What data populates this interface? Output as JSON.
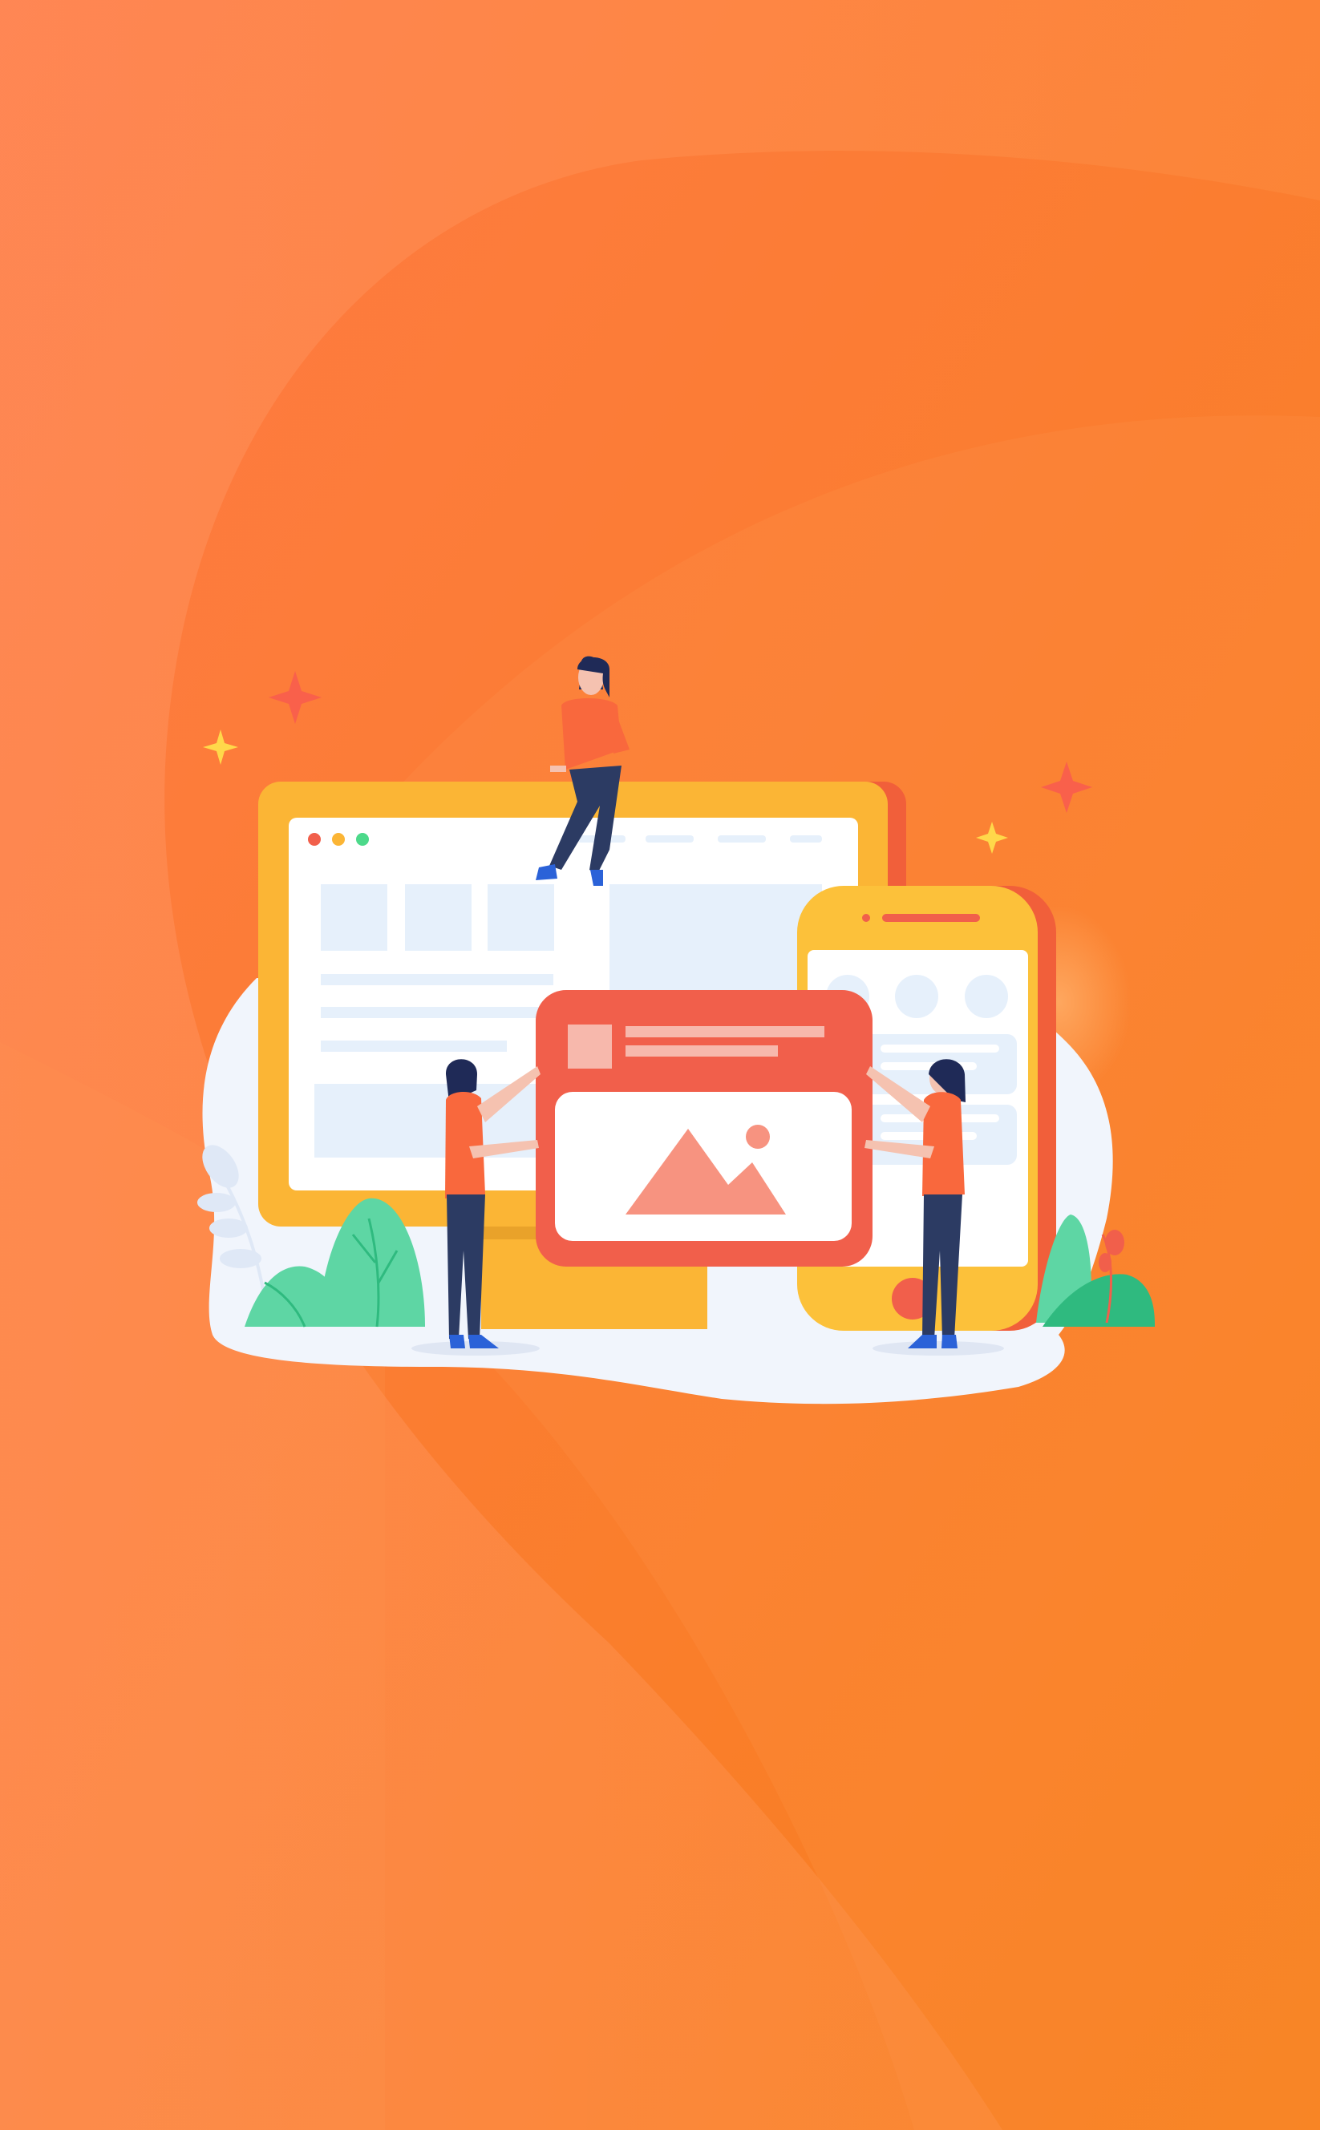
{
  "screen": {
    "kind": "splash-illustration",
    "description_visible_text": "",
    "text_labels": []
  },
  "palette": {
    "bg_top_left": "#ff7a45",
    "bg_bottom_right": "#f7801c",
    "bg_swoosh": "#ff8f5a",
    "monitor_frame": "#fbb535",
    "monitor_frame_shadow": "#f15f3a",
    "screen_white": "#ffffff",
    "placeholder_blue": "#e6f0fb",
    "accent_red": "#f15f4b",
    "accent_salmon": "#f79380",
    "phone_frame": "#fcc13a",
    "plant_green": "#5ed6a4",
    "plant_green_dark": "#2fba7f",
    "figure_shirt": "#f9683d",
    "figure_pants": "#2c3b63",
    "figure_hair": "#1f2a57",
    "figure_shoes": "#2b62d8",
    "sparkle_red": "#f9604b",
    "sparkle_yellow": "#ffd84a",
    "window_dot_red": "#f15f4b",
    "window_dot_yellow": "#fbb535",
    "window_dot_green": "#4cd98a"
  },
  "icons": [
    "sparkle-icon",
    "mountain-image-icon",
    "browser-window-icon",
    "smartphone-icon",
    "plant-icon",
    "person-icon"
  ]
}
